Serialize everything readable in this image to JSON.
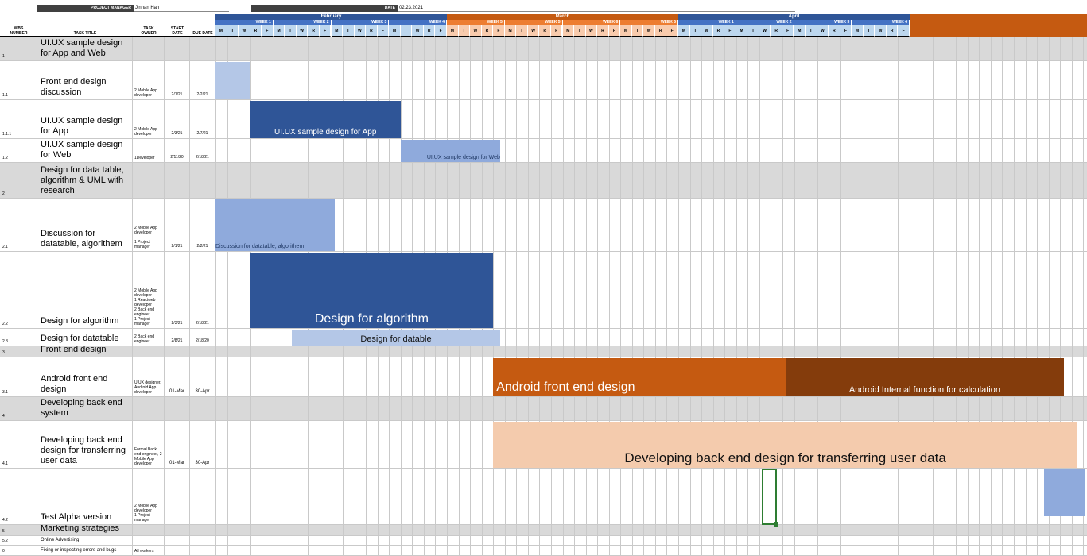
{
  "header": {
    "project_manager_label": "PROJECT MANAGER",
    "project_manager": "Jinhan Han",
    "date_label": "DATE",
    "date": "02.23.2021"
  },
  "columns": {
    "wbs_number": "WBS\nNUMBER",
    "task_title": "TASK TITLE",
    "task_owner": "TASK\nOWNER",
    "start_date": "START\nDATE",
    "due_date": "DUE DATE"
  },
  "months": [
    {
      "label": "February",
      "color": "#2f5597"
    },
    {
      "label": "March",
      "color": "#c55a11"
    },
    {
      "label": "April",
      "color": "#2f5597"
    }
  ],
  "weeks": [
    {
      "label": "WEEK 1"
    },
    {
      "label": "WEEK 2"
    },
    {
      "label": "WEEK 3"
    },
    {
      "label": "WEEK 4"
    },
    {
      "label": "WEEK 5"
    },
    {
      "label": "WEEK 5"
    },
    {
      "label": "WEEK 6"
    },
    {
      "label": "WEEK 5"
    },
    {
      "label": "WEEK 1"
    },
    {
      "label": "WEEK 2"
    },
    {
      "label": "WEEK 3"
    },
    {
      "label": "WEEK 4"
    }
  ],
  "day_letters": [
    "M",
    "T",
    "W",
    "R",
    "F"
  ],
  "rows": [
    {
      "wbs": "1",
      "title": "UI.UX sample design for App and Web",
      "owner": "",
      "start": "",
      "due": "",
      "section": true
    },
    {
      "wbs": "1.1",
      "title": "Front end design discussion",
      "owner": "2 Mobile App developer",
      "start": "2/1/21",
      "due": "2/2/21",
      "section": false
    },
    {
      "wbs": "1.1.1",
      "title": "UI.UX sample design for App",
      "owner": "2 Mobile App developer",
      "start": "2/3/21",
      "due": "2/7/21",
      "section": false
    },
    {
      "wbs": "1.2",
      "title": "UI.UX sample design for Web",
      "owner": "1Developer",
      "start": "2/11/20",
      "due": "2/18/21",
      "section": false
    },
    {
      "wbs": "2",
      "title": "Design for data table, algorithm & UML with research",
      "owner": "",
      "start": "",
      "due": "",
      "section": true
    },
    {
      "wbs": "2.1",
      "title": "Discussion for datatable, algorithem",
      "owner": "2 Mobile App developer\n\n1 Project manager",
      "start": "2/1/21",
      "due": "2/2/21",
      "section": false
    },
    {
      "wbs": "2.2",
      "title": "Design for algorithm",
      "owner": "2 Mobile App developer\n1 Reactweb developer\n2 Back end engineer\n1 Project manager",
      "start": "2/3/21",
      "due": "2/18/21",
      "section": false
    },
    {
      "wbs": "2.3",
      "title": "Design for datatable",
      "owner": "2 Back end engineer",
      "start": "2/8/21",
      "due": "2/18/20",
      "section": false
    },
    {
      "wbs": "3",
      "title": "Front end design",
      "owner": "",
      "start": "",
      "due": "",
      "section": true
    },
    {
      "wbs": "3.1",
      "title": "Android front end design",
      "owner": "UIUX designer, Android App developer",
      "start": "01-Mar",
      "due": "30-Apr",
      "section": false
    },
    {
      "wbs": "4",
      "title": "Developing back end system",
      "owner": "",
      "start": "",
      "due": "",
      "section": true
    },
    {
      "wbs": "4.1",
      "title": "Developing back end design for transferring user data",
      "owner": "Formal Back end engineer, 2 Mobile App developer",
      "start": "01-Mar",
      "due": "30-Apr",
      "section": false
    },
    {
      "wbs": "4.2",
      "title": "Test Alpha version",
      "owner": "2 Mobile App developer\n1 Project manager",
      "start": "",
      "due": "",
      "section": false
    },
    {
      "wbs": "5",
      "title": "Marketing strategies",
      "owner": "",
      "start": "",
      "due": "",
      "section": true
    },
    {
      "wbs": "5.2",
      "title": "Online Advertising",
      "owner": "",
      "start": "",
      "due": "",
      "section": false
    },
    {
      "wbs": "0",
      "title": "Fixing or inspecting errors and bugs",
      "owner": "All workers",
      "start": "",
      "due": "",
      "section": false
    }
  ],
  "bars": [
    {
      "label": "",
      "color": "#b4c7e7"
    },
    {
      "label": "UI.UX sample design for App",
      "color": "#2f5597"
    },
    {
      "label": "UI.UX sample design for Web",
      "color": "#8faadc"
    },
    {
      "label": "Discussion for datatable, algorithem",
      "color": "#8faadc"
    },
    {
      "label": "Design for algorithm",
      "color": "#2f5597"
    },
    {
      "label": "Design for datable",
      "color": "#b4c7e7"
    },
    {
      "label": "Android front end design",
      "color": "#c55a11"
    },
    {
      "label": "Android Internal function for calculation",
      "color": "#843c0c"
    },
    {
      "label": "Developing back end design for transferring user data",
      "color": "#f4cbad"
    },
    {
      "label": "",
      "color": "#8faadc"
    }
  ]
}
